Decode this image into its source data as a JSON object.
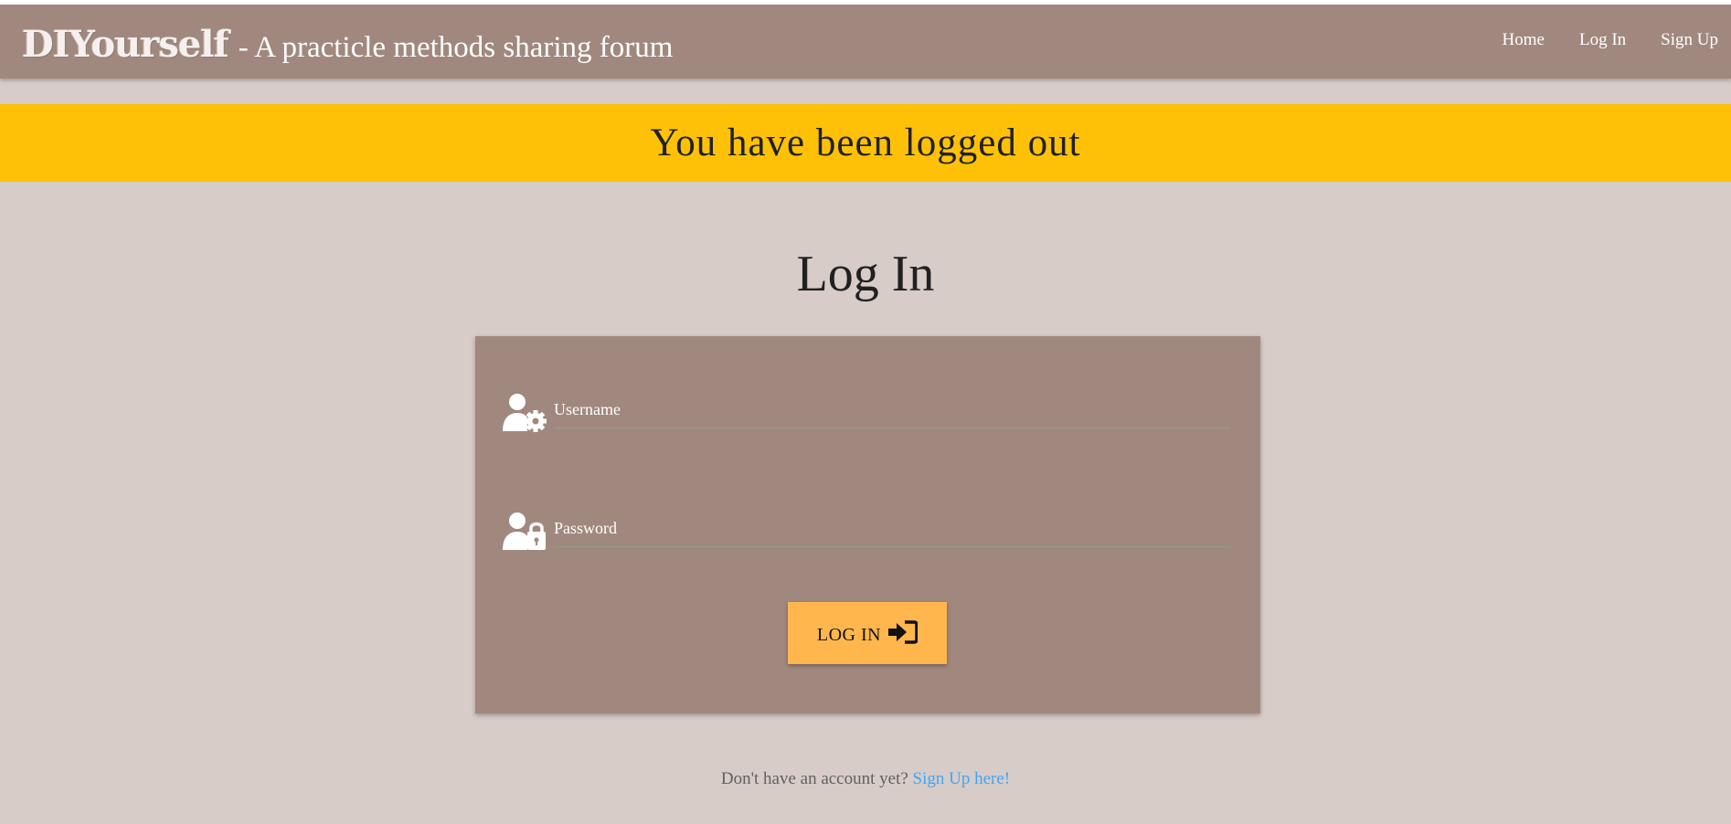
{
  "navbar": {
    "brand_logo": "DIYourself",
    "brand_tagline": "- A practicle methods sharing forum",
    "links": [
      {
        "label": "Home"
      },
      {
        "label": "Log In"
      },
      {
        "label": "Sign Up"
      }
    ]
  },
  "alert": {
    "message": "You have been logged out",
    "color": "#ffc107"
  },
  "page": {
    "title": "Log In"
  },
  "form": {
    "username": {
      "placeholder": "Username",
      "value": "",
      "icon": "user-gear-icon"
    },
    "password": {
      "placeholder": "Password",
      "value": "",
      "icon": "user-lock-icon"
    },
    "submit_label": "LOG IN",
    "submit_icon": "sign-in-icon"
  },
  "footer": {
    "prompt": "Don't have an account yet?",
    "link_label": "Sign Up here!"
  },
  "colors": {
    "navbar": "#a1887f",
    "background": "#d7ccc8",
    "button": "#ffb74d",
    "link": "#42a5f5"
  }
}
